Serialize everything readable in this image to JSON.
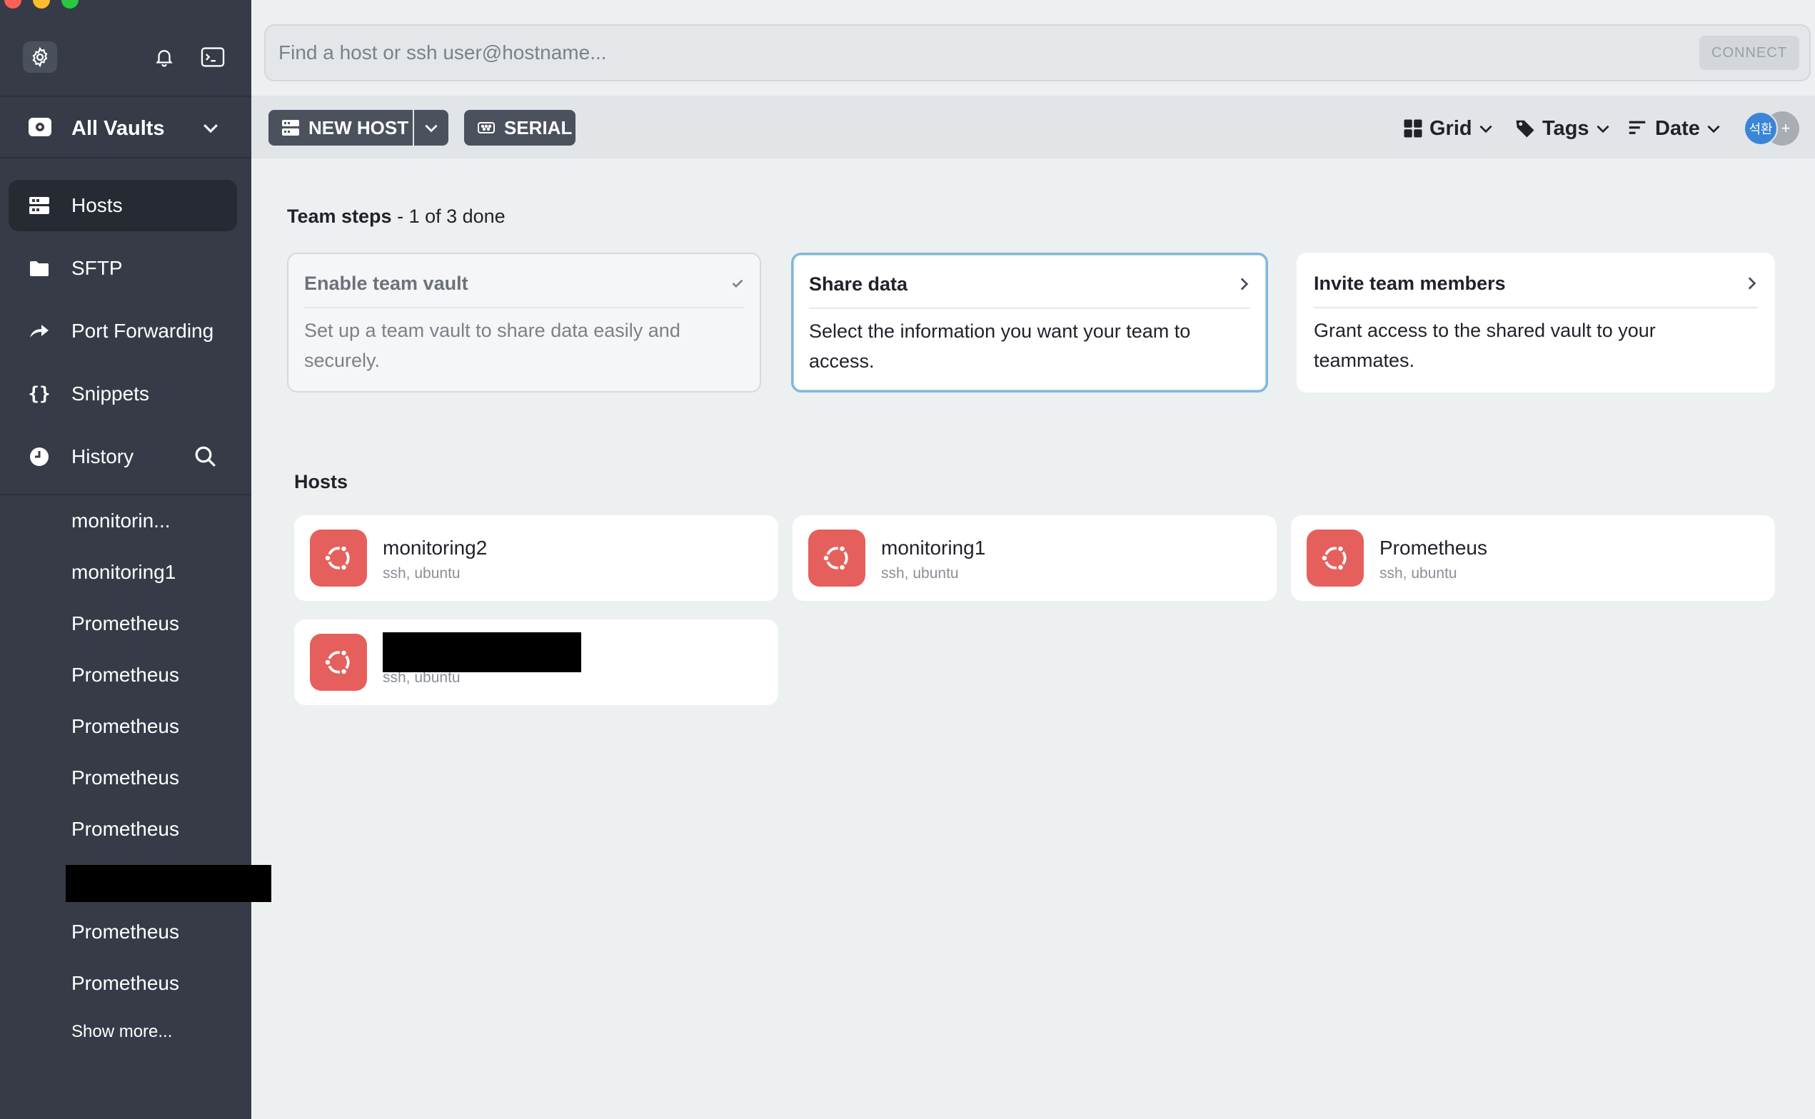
{
  "sidebar": {
    "vault_label": "All Vaults",
    "nav": [
      {
        "label": "Hosts",
        "icon": "hosts-icon"
      },
      {
        "label": "SFTP",
        "icon": "folder-icon"
      },
      {
        "label": "Port Forwarding",
        "icon": "port-forwarding-icon"
      },
      {
        "label": "Snippets",
        "icon": "snippets-icon"
      },
      {
        "label": "History",
        "icon": "clock-icon"
      }
    ],
    "history": [
      "monitorin...",
      "monitoring1",
      "Prometheus",
      "Prometheus",
      "Prometheus",
      "Prometheus",
      "Prometheus",
      "Prometheus",
      "Prometheus"
    ],
    "show_more": "Show more..."
  },
  "search": {
    "placeholder": "Find a host or ssh user@hostname...",
    "connect_label": "CONNECT"
  },
  "toolbar": {
    "new_host_label": "NEW HOST",
    "serial_label": "SERIAL",
    "view_label": "Grid",
    "tags_label": "Tags",
    "sort_label": "Date",
    "avatar_initials": "석환",
    "add_member": "+"
  },
  "team_steps": {
    "title": "Team steps",
    "progress": "- 1 of 3 done",
    "steps": [
      {
        "title": "Enable team vault",
        "desc": "Set up a team vault to share data easily and securely.",
        "done": true
      },
      {
        "title": "Share data",
        "desc": "Select the information you want your team to access.",
        "done": false
      },
      {
        "title": "Invite team members",
        "desc": "Grant access to the shared vault to your teammates.",
        "done": false
      }
    ]
  },
  "hosts": {
    "title": "Hosts",
    "items": [
      {
        "name": "monitoring2",
        "sub": "ssh, ubuntu"
      },
      {
        "name": "monitoring1",
        "sub": "ssh, ubuntu"
      },
      {
        "name": "Prometheus",
        "sub": "ssh, ubuntu"
      },
      {
        "name": "",
        "sub": "ssh, ubuntu"
      }
    ]
  },
  "colors": {
    "sidebar_bg": "#363b47",
    "accent_ubuntu": "#e5605c",
    "avatar_blue": "#3a85d8"
  }
}
